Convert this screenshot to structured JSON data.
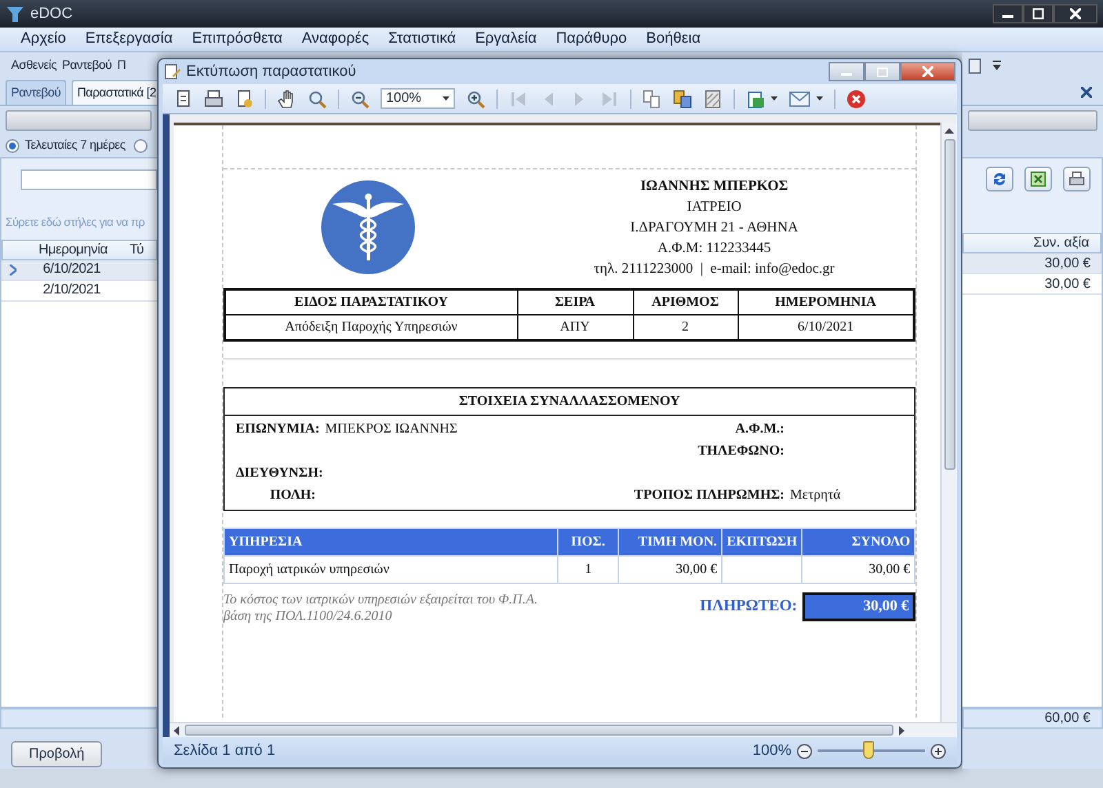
{
  "window": {
    "title": "eDOC"
  },
  "menu": [
    "Αρχείο",
    "Επεξεργασία",
    "Επιπρόσθετα",
    "Αναφορές",
    "Στατιστικά",
    "Εργαλεία",
    "Παράθυρο",
    "Βοήθεια"
  ],
  "toolbar": [
    "Ασθενείς",
    "Ραντεβού",
    "Π"
  ],
  "tabs": [
    {
      "label": "Ραντεβού",
      "selected": false
    },
    {
      "label": "Παραστατικά [2",
      "selected": true
    }
  ],
  "filters": [
    {
      "label": "Τελευταίες 7 ημέρες",
      "selected": true
    },
    {
      "selected": false
    }
  ],
  "group_hint": "Σύρετε εδώ στήλες για να πρ",
  "grid": {
    "columns": [
      "Ημερομηνία",
      "Τύ",
      "Συν. αξία"
    ],
    "rows": [
      {
        "date": "6/10/2021",
        "value": "30,00 €",
        "selected": true
      },
      {
        "date": "2/10/2021",
        "value": "30,00 €",
        "selected": false
      }
    ],
    "total": "60,00 €"
  },
  "view_button": "Προβολή",
  "dialog": {
    "title": "Εκτύπωση παραστατικού",
    "zoom_box": "100%",
    "status": "Σελίδα 1 από 1",
    "zoom_reading": "100%",
    "zoom_slider": {
      "level": 0.47
    },
    "document": {
      "issuer": [
        "ΙΩΑΝΝΗΣ ΜΠΕΡΚΟΣ",
        "ΙΑΤΡΕΙΟ",
        "Ι.ΔΡΑΓΟΥΜΗ 21 - ΑΘΗΝΑ",
        "Α.Φ.Μ: 112233445",
        "τηλ. 2111223000  |  e-mail: info@edoc.gr"
      ],
      "doc_table": {
        "columns": [
          "ΕΙΔΟΣ ΠΑΡΑΣΤΑΤΙΚΟΥ",
          "ΣΕΙΡΑ",
          "ΑΡΙΘΜΟΣ",
          "ΗΜΕΡΟΜΗΝΙΑ"
        ],
        "row": [
          "Απόδειξη Παροχής Υπηρεσιών",
          "ΑΠΥ",
          "2",
          "6/10/2021"
        ]
      },
      "customer": {
        "title": "ΣΤΟΙΧΕΙΑ ΣΥΝΑΛΛΑΣΣΟΜΕΝΟΥ",
        "rows": [
          {
            "left": {
              "label": "ΕΠΩΝΥΜΙΑ:",
              "value": "ΜΠΕΚΡΟΣ ΙΩΑΝΝΗΣ"
            },
            "right": {
              "label": "Α.Φ.Μ.:"
            }
          },
          {
            "right": {
              "label": "ΤΗΛΕΦΩΝΟ:"
            }
          },
          {
            "left": {
              "label": "ΔΙΕΥΘΥΝΣΗ:"
            }
          },
          {
            "left": {
              "label": "ΠΟΛΗ:"
            },
            "right": {
              "label": "ΤΡΟΠΟΣ ΠΛΗΡΩΜΗΣ:",
              "value": "Μετρητά"
            }
          }
        ]
      },
      "services": {
        "columns": [
          "ΥΠΗΡΕΣΙΑ",
          "ΠΟΣ.",
          "ΤΙΜΗ ΜΟΝ.",
          "ΕΚΠΤΩΣΗ",
          "ΣΥΝΟΛΟ"
        ],
        "rows": [
          {
            "service": "Παροχή ιατρικών υπηρεσιών",
            "qty": "1",
            "price": "30,00 €",
            "total": "30,00 €"
          }
        ]
      },
      "note": "Το κόστος των ιατρικών υπηρεσιών εξαιρείται του Φ.Π.Α. βάση της ΠΟΛ.1100/24.6.2010",
      "payable_label": "ΠΛΗΡΩΤΕΟ:",
      "payable_value": "30,00 €"
    }
  }
}
